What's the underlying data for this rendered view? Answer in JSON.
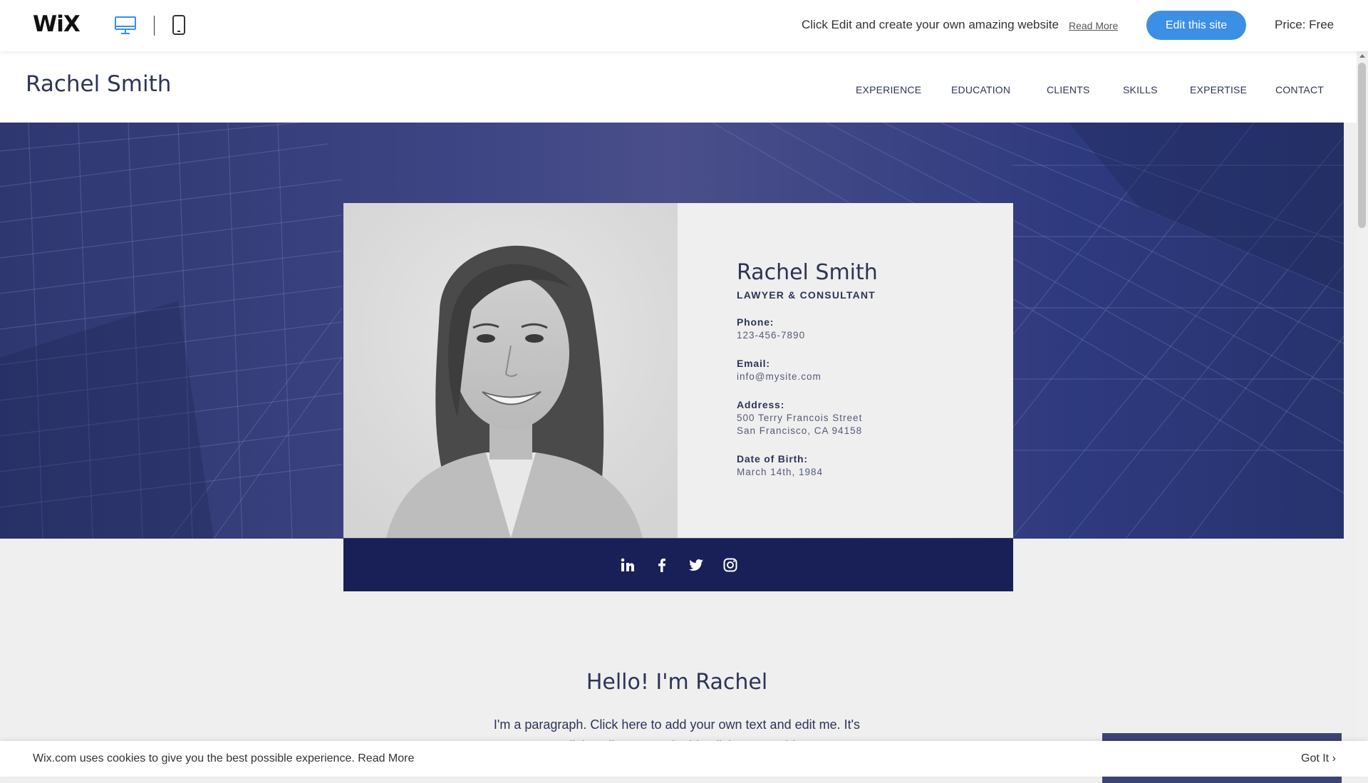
{
  "wix_bar": {
    "logo": "WiX",
    "promo_text": "Click Edit and create your own amazing website",
    "read_more": "Read More",
    "edit_button": "Edit this site",
    "price": "Price: Free",
    "active_device": "desktop"
  },
  "site": {
    "name": "Rachel Smith",
    "nav": [
      "EXPERIENCE",
      "EDUCATION",
      "CLIENTS",
      "SKILLS",
      "EXPERTISE",
      "CONTACT"
    ]
  },
  "profile": {
    "name": "Rachel Smith",
    "role": "LAWYER & CONSULTANT",
    "phone_label": "Phone:",
    "phone": "123-456-7890",
    "email_label": "Email:",
    "email": "info@mysite.com",
    "address_label": "Address:",
    "address_line1": "500 Terry Francois Street",
    "address_line2": "San Francisco, CA 94158",
    "dob_label": "Date of Birth:",
    "dob": "March 14th, 1984"
  },
  "social": [
    "linkedin-icon",
    "facebook-icon",
    "twitter-icon",
    "instagram-icon"
  ],
  "about": {
    "title": "Hello! I'm Rachel",
    "paragraph": "I'm a paragraph. Click here to add your own text and edit me. It's easy. Just click “Edit Text” or double click me to add your own content."
  },
  "cookie": {
    "text": "Wix.com uses cookies to give you the best possible experience.",
    "read_more": "Read More",
    "got_it": "Got It ›"
  },
  "colors": {
    "brand_navy": "#182057",
    "edit_button": "#3b8fe4",
    "text_navy": "#2d3457"
  }
}
